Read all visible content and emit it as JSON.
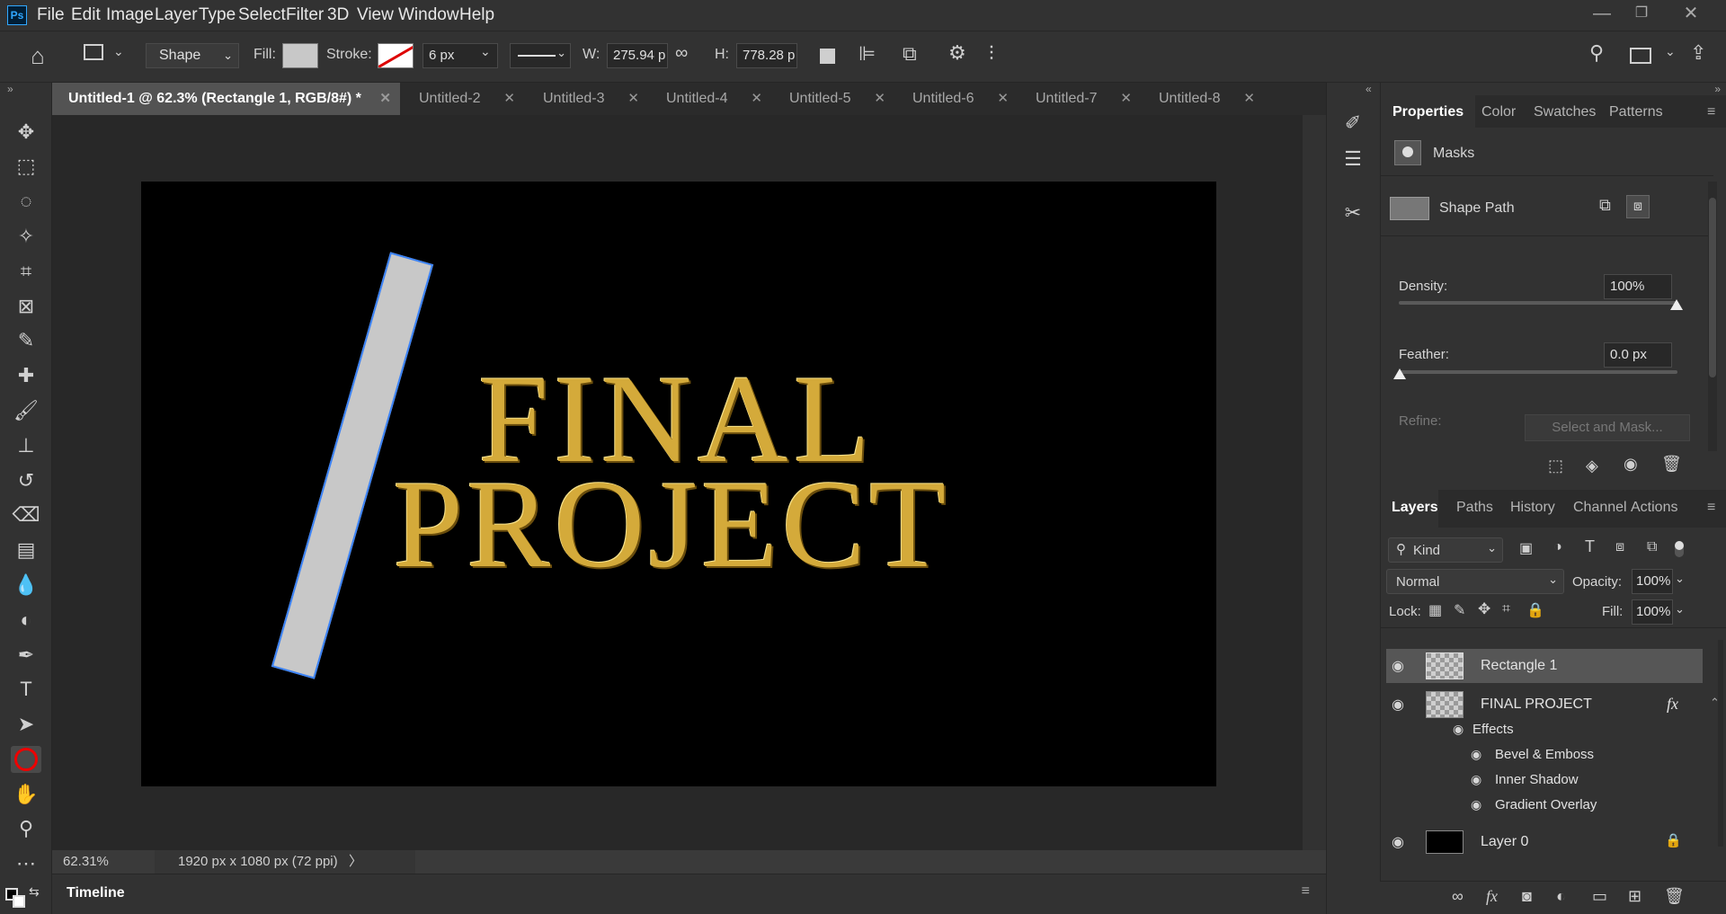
{
  "app": {
    "logo": "Ps"
  },
  "menu": [
    "File",
    "Edit",
    "Image",
    "Layer",
    "Type",
    "Select",
    "Filter",
    "3D",
    "View",
    "Window",
    "Help"
  ],
  "options": {
    "mode": "Shape",
    "fill_label": "Fill:",
    "stroke_label": "Stroke:",
    "stroke_width": "6 px",
    "w_label": "W:",
    "w_value": "275.94 p",
    "h_label": "H:",
    "h_value": "778.28 p"
  },
  "tabs": [
    {
      "label": "Untitled-1 @ 62.3% (Rectangle 1, RGB/8#) *",
      "active": true
    },
    {
      "label": "Untitled-2"
    },
    {
      "label": "Untitled-3"
    },
    {
      "label": "Untitled-4"
    },
    {
      "label": "Untitled-5"
    },
    {
      "label": "Untitled-6"
    },
    {
      "label": "Untitled-7"
    },
    {
      "label": "Untitled-8"
    }
  ],
  "canvas": {
    "line1": "FINAL",
    "line2": "PROJECT",
    "bg_color": "#000000",
    "shape_color": "#c8c8c8",
    "text_color": "#c9a227"
  },
  "status": {
    "zoom": "62.31%",
    "doc_info": "1920 px x 1080 px (72 ppi)"
  },
  "timeline": {
    "label": "Timeline"
  },
  "properties": {
    "tabs": [
      "Properties",
      "Color",
      "Swatches",
      "Patterns"
    ],
    "masks_label": "Masks",
    "shape_path_label": "Shape Path",
    "density_label": "Density:",
    "density_value": "100%",
    "feather_label": "Feather:",
    "feather_value": "0.0 px",
    "refine_label": "Refine:",
    "select_mask_label": "Select and Mask..."
  },
  "layers_panel": {
    "tabs": [
      "Layers",
      "Paths",
      "History",
      "Channels",
      "Actions"
    ],
    "kind_label": "Kind",
    "blend_mode": "Normal",
    "opacity_label": "Opacity:",
    "opacity_value": "100%",
    "lock_label": "Lock:",
    "fill_label": "Fill:",
    "fill_value": "100%",
    "layers": [
      {
        "name": "Rectangle 1",
        "selected": true
      },
      {
        "name": "FINAL PROJECT",
        "fx": "fx"
      },
      {
        "name": "Effects"
      },
      {
        "name": "Bevel & Emboss"
      },
      {
        "name": "Inner Shadow"
      },
      {
        "name": "Gradient Overlay"
      },
      {
        "name": "Layer 0"
      }
    ]
  }
}
